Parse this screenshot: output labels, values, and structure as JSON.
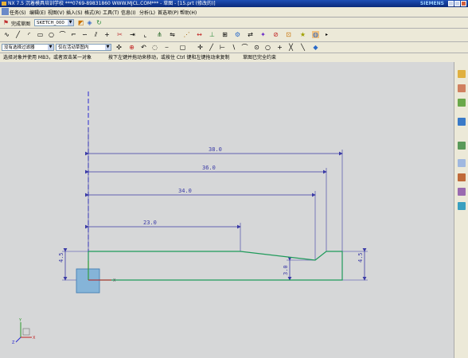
{
  "window": {
    "title": "NX 7.5 沉着模具培训学校 ***0769-89831860 WWW.MJCL.COM*** - 草图 - [15.prt (修改的)]",
    "brand": "SIEMENS"
  },
  "menu": [
    "任务(S)",
    "编辑(E)",
    "视图(V)",
    "插入(S)",
    "格式(R)",
    "工具(T)",
    "信息(I)",
    "分析(L)",
    "首选项(P)",
    "帮助(H)"
  ],
  "toolbar2": {
    "finish_label": "完成草图",
    "sketch_name": "SKETCH_000"
  },
  "toolbar4": {
    "filter_label": "没有选择过滤器",
    "scope_label": "仅在活动草图内"
  },
  "status": {
    "prompt": "选择对象并使用 MB3，或者双击某一对象",
    "hint": "按下左键并拖动来移动，或按住 Ctrl 键和左键拖动来复制",
    "message": "草图已完全约束"
  },
  "dimensions": {
    "d38": "38.0",
    "d36": "36.0",
    "d34": "34.0",
    "d23": "23.0",
    "left_h": "4.5",
    "right_h": "4.5",
    "step_h": "3.0"
  },
  "axis": {
    "x": "X",
    "y": "Y",
    "z": "Z"
  },
  "colors": {
    "profile": "#1f9a5a",
    "dimension": "#3a3aa6",
    "centerline": "#2a2ad0",
    "datum_box": "#6aa8d8",
    "canvas": "#d6d7d8"
  }
}
